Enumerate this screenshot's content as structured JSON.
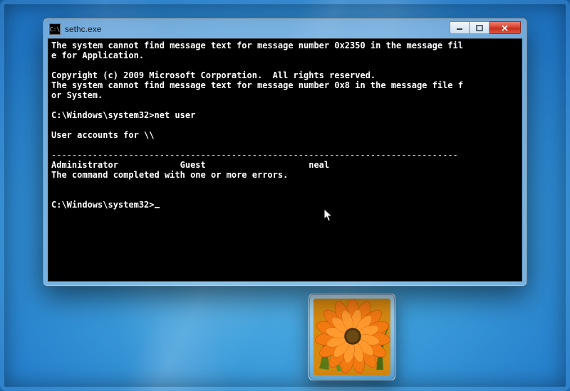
{
  "window": {
    "title": "sethc.exe",
    "controls": {
      "minimize_title": "Minimize",
      "maximize_title": "Maximize",
      "close_title": "Close"
    }
  },
  "console": {
    "line1": "The system cannot find message text for message number 0x2350 in the message fil",
    "line2": "e for Application.",
    "blank1": "",
    "copyright": "Copyright (c) 2009 Microsoft Corporation.  All rights reserved.",
    "line3": "The system cannot find message text for message number 0x8 in the message file f",
    "line4": "or System.",
    "blank2": "",
    "prompt1_path": "C:\\Windows\\system32>",
    "prompt1_cmd": "net user",
    "blank3": "",
    "header": "User accounts for \\\\",
    "blank4": "",
    "divider": "-------------------------------------------------------------------------------",
    "users_line": "Administrator            Guest                    neal",
    "completion": "The command completed with one or more errors.",
    "blank5": "",
    "blank6": "",
    "prompt2_path": "C:\\Windows\\system32>"
  },
  "avatar": {
    "description": "orange flower user picture"
  }
}
